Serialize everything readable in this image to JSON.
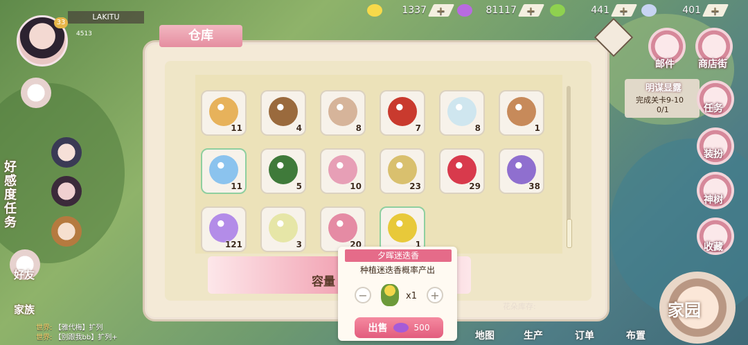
{
  "resources": [
    {
      "icon": "star-icon",
      "value": "1337",
      "color": "#f7d94a"
    },
    {
      "icon": "candy-icon",
      "value": "81117",
      "color": "#b86be0"
    },
    {
      "icon": "leaf-icon",
      "value": "441",
      "color": "#8fd14f"
    },
    {
      "icon": "cloud-icon",
      "value": "401",
      "color": "#c7d4f2"
    }
  ],
  "player": {
    "name": "LAKITU",
    "level": "33",
    "id": "4513"
  },
  "panel": {
    "title": "仓库",
    "capacity_label": "容量"
  },
  "items": [
    {
      "icon": "pie-icon",
      "count": "11",
      "color": "#e7b25b"
    },
    {
      "icon": "stump-icon",
      "count": "4",
      "color": "#9a6a3d"
    },
    {
      "icon": "flour-sack-icon",
      "count": "8",
      "color": "#d6b49a"
    },
    {
      "icon": "goji-berry-icon",
      "count": "7",
      "color": "#c93a2e"
    },
    {
      "icon": "white-chrysanthemum-icon",
      "count": "8",
      "color": "#cfe6ef"
    },
    {
      "icon": "mushroom-icon",
      "count": "1",
      "color": "#c78a5a"
    },
    {
      "icon": "crystal-star-icon",
      "count": "11",
      "color": "#8bc3ee",
      "highlight": true
    },
    {
      "icon": "herb-leaf-icon",
      "count": "5",
      "color": "#3f7a3a"
    },
    {
      "icon": "pink-nest-icon",
      "count": "10",
      "color": "#e79fb6"
    },
    {
      "icon": "egg-nest-icon",
      "count": "23",
      "color": "#d9c06e"
    },
    {
      "icon": "radish-icon",
      "count": "29",
      "color": "#d83a4c"
    },
    {
      "icon": "lavender-icon",
      "count": "38",
      "color": "#8f6fcf"
    },
    {
      "icon": "purple-flower-icon",
      "count": "121",
      "color": "#b38ce8"
    },
    {
      "icon": "citrus-slice-icon",
      "count": "3",
      "color": "#e6e6a7"
    },
    {
      "icon": "flower-basket-icon",
      "count": "20",
      "color": "#e58ba4"
    },
    {
      "icon": "rosemary-icon",
      "count": "1",
      "color": "#e8c93a",
      "highlight": true
    }
  ],
  "popup": {
    "title": "夕晖迷迭香",
    "desc": "种植迷迭香概率产出",
    "qty": "x1",
    "minus": "−",
    "plus": "+",
    "sell_label": "出售",
    "price": "500"
  },
  "right_menu": {
    "mail": "邮件",
    "shop": "商店街",
    "quest_title": "明谋显露",
    "quest_desc": "完成关卡9-10",
    "quest_progress": "0/1",
    "task": "任务",
    "dress": "装扮",
    "tree": "神树",
    "collect": "收藏",
    "home": "家园"
  },
  "left_menu": {
    "goodwill": "好感度任务",
    "friends": "好友",
    "family": "家族"
  },
  "chat": [
    {
      "tag": "世界:",
      "text": "【雅代梅】扩列"
    },
    {
      "tag": "世界:",
      "text": "【别跟我bb】扩列+"
    }
  ],
  "bottom_nav": {
    "map": "地图",
    "produce": "生产",
    "order": "订单",
    "layout": "布置"
  },
  "misc": {
    "flower_stock": "花朵库存:"
  }
}
